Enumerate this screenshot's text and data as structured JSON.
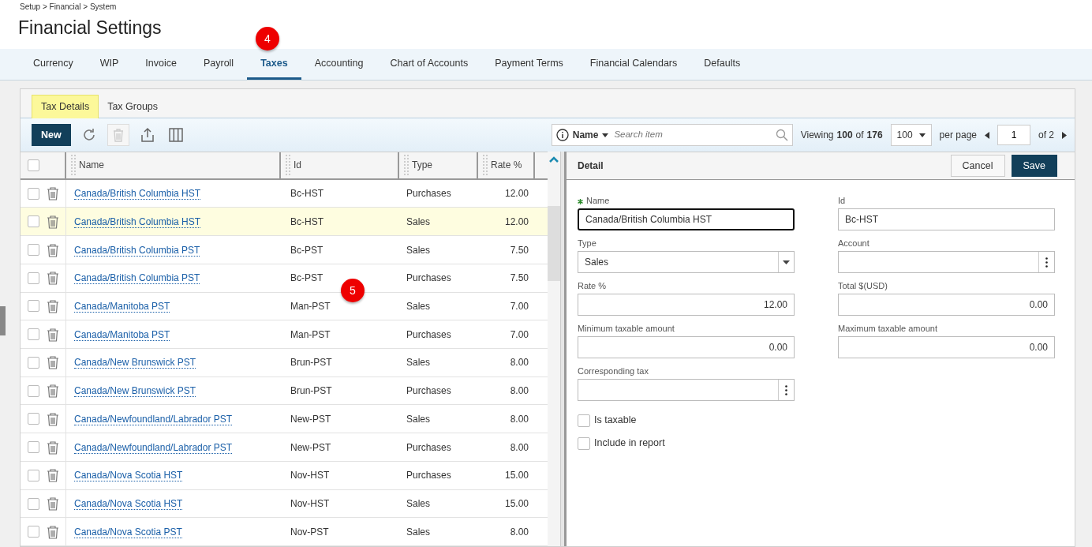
{
  "breadcrumb": "Setup > Financial > System",
  "title": "Financial Settings",
  "tabs": [
    {
      "label": "Currency",
      "selected": false
    },
    {
      "label": "WIP",
      "selected": false
    },
    {
      "label": "Invoice",
      "selected": false
    },
    {
      "label": "Payroll",
      "selected": false
    },
    {
      "label": "Taxes",
      "selected": true
    },
    {
      "label": "Accounting",
      "selected": false
    },
    {
      "label": "Chart of Accounts",
      "selected": false
    },
    {
      "label": "Payment Terms",
      "selected": false
    },
    {
      "label": "Financial Calendars",
      "selected": false
    },
    {
      "label": "Defaults",
      "selected": false
    }
  ],
  "callouts": [
    {
      "label": "4",
      "kind": "tab"
    },
    {
      "label": "5",
      "kind": "grid"
    }
  ],
  "subtabs": [
    {
      "label": "Tax Details",
      "selected": true
    },
    {
      "label": "Tax Groups",
      "selected": false
    }
  ],
  "toolbar": {
    "new_button": "New",
    "search_by": "Name",
    "search_placeholder": "Search item",
    "viewing": "Viewing",
    "shown": "100",
    "of": "of",
    "total": "176",
    "page_size": "100",
    "per_page": "per page",
    "page": "1",
    "of_pages": "of 2"
  },
  "table": {
    "select_all_checked": false,
    "columns": [
      "Name",
      "Id",
      "Type",
      "Rate %"
    ],
    "rows": [
      {
        "name": "Canada/British Columbia HST",
        "id": "Bc-HST",
        "type": "Purchases",
        "rate": "12.00",
        "checked": false,
        "selected": false
      },
      {
        "name": "Canada/British Columbia HST",
        "id": "Bc-HST",
        "type": "Sales",
        "rate": "12.00",
        "checked": false,
        "selected": true
      },
      {
        "name": "Canada/British Columbia PST",
        "id": "Bc-PST",
        "type": "Sales",
        "rate": "7.50",
        "checked": false,
        "selected": false
      },
      {
        "name": "Canada/British Columbia PST",
        "id": "Bc-PST",
        "type": "Purchases",
        "rate": "7.50",
        "checked": false,
        "selected": false
      },
      {
        "name": "Canada/Manitoba PST",
        "id": "Man-PST",
        "type": "Sales",
        "rate": "7.00",
        "checked": false,
        "selected": false
      },
      {
        "name": "Canada/Manitoba PST",
        "id": "Man-PST",
        "type": "Purchases",
        "rate": "7.00",
        "checked": false,
        "selected": false
      },
      {
        "name": "Canada/New Brunswick PST",
        "id": "Brun-PST",
        "type": "Sales",
        "rate": "8.00",
        "checked": false,
        "selected": false
      },
      {
        "name": "Canada/New Brunswick PST",
        "id": "Brun-PST",
        "type": "Purchases",
        "rate": "8.00",
        "checked": false,
        "selected": false
      },
      {
        "name": "Canada/Newfoundland/Labrador PST",
        "id": "New-PST",
        "type": "Sales",
        "rate": "8.00",
        "checked": false,
        "selected": false
      },
      {
        "name": "Canada/Newfoundland/Labrador PST",
        "id": "New-PST",
        "type": "Purchases",
        "rate": "8.00",
        "checked": false,
        "selected": false
      },
      {
        "name": "Canada/Nova Scotia HST",
        "id": "Nov-HST",
        "type": "Purchases",
        "rate": "15.00",
        "checked": false,
        "selected": false
      },
      {
        "name": "Canada/Nova Scotia HST",
        "id": "Nov-HST",
        "type": "Sales",
        "rate": "15.00",
        "checked": false,
        "selected": false
      },
      {
        "name": "Canada/Nova Scotia PST",
        "id": "Nov-PST",
        "type": "Sales",
        "rate": "8.00",
        "checked": false,
        "selected": false
      }
    ]
  },
  "detail": {
    "title": "Detail",
    "cancel": "Cancel",
    "save": "Save",
    "fields": [
      {
        "label": "Name",
        "value": "Canada/British Columbia HST",
        "kind": "text",
        "required": true,
        "focused": true
      },
      {
        "label": "Id",
        "value": "Bc-HST",
        "kind": "text",
        "required": false,
        "focused": false
      },
      {
        "label": "Type",
        "value": "Sales",
        "kind": "select",
        "required": false,
        "focused": false
      },
      {
        "label": "Account",
        "kind": "lookup",
        "required": false,
        "focused": false
      },
      {
        "label": "Rate %",
        "value": "12.00",
        "kind": "number",
        "required": false,
        "focused": false
      },
      {
        "label": "Total $(USD)",
        "value": "0.00",
        "kind": "number",
        "required": false,
        "focused": false
      },
      {
        "label": "Minimum taxable amount",
        "value": "0.00",
        "kind": "number",
        "required": false,
        "focused": false
      },
      {
        "label": "Maximum taxable amount",
        "value": "0.00",
        "kind": "number",
        "required": false,
        "focused": false
      },
      {
        "label": "Corresponding tax",
        "kind": "lookup",
        "required": false,
        "focused": false
      }
    ],
    "checkboxes": [
      {
        "label": "Is taxable",
        "checked": false
      },
      {
        "label": "Include in report",
        "checked": false
      }
    ]
  }
}
